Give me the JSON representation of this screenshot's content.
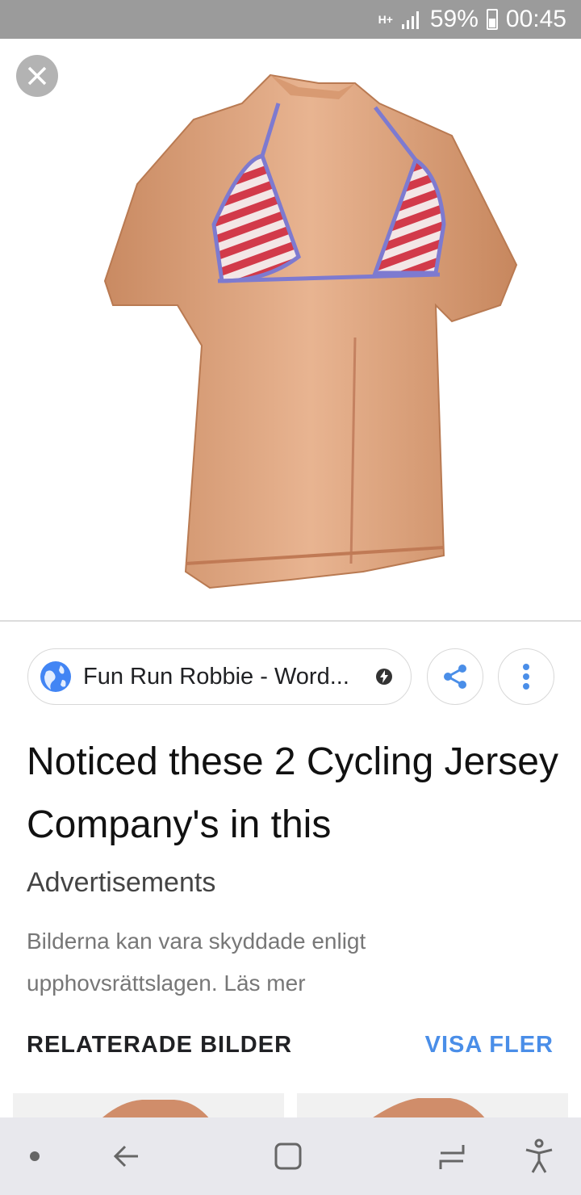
{
  "status_bar": {
    "network": "H+",
    "battery": "59%",
    "time": "00:45"
  },
  "image": {
    "description_icon": "jersey-image"
  },
  "source": {
    "label": "Fun Run Robbie - Word...",
    "icon": "globe-icon",
    "badge_icon": "amp-bolt-icon"
  },
  "actions": {
    "share_icon": "share-icon",
    "more_icon": "more-vert-icon"
  },
  "title": "Noticed these 2 Cycling Jersey Company's in this",
  "subtitle": "Advertisements",
  "notice": "Bilderna kan vara skyddade enligt upphovsrättslagen. Läs mer",
  "related": {
    "header": "RELATERADE BILDER",
    "more_link": "VISA FLER"
  },
  "colors": {
    "accent": "#4a8ee8",
    "status_bar": "#9b9b9b",
    "nav_bar": "#e8e8ed"
  }
}
